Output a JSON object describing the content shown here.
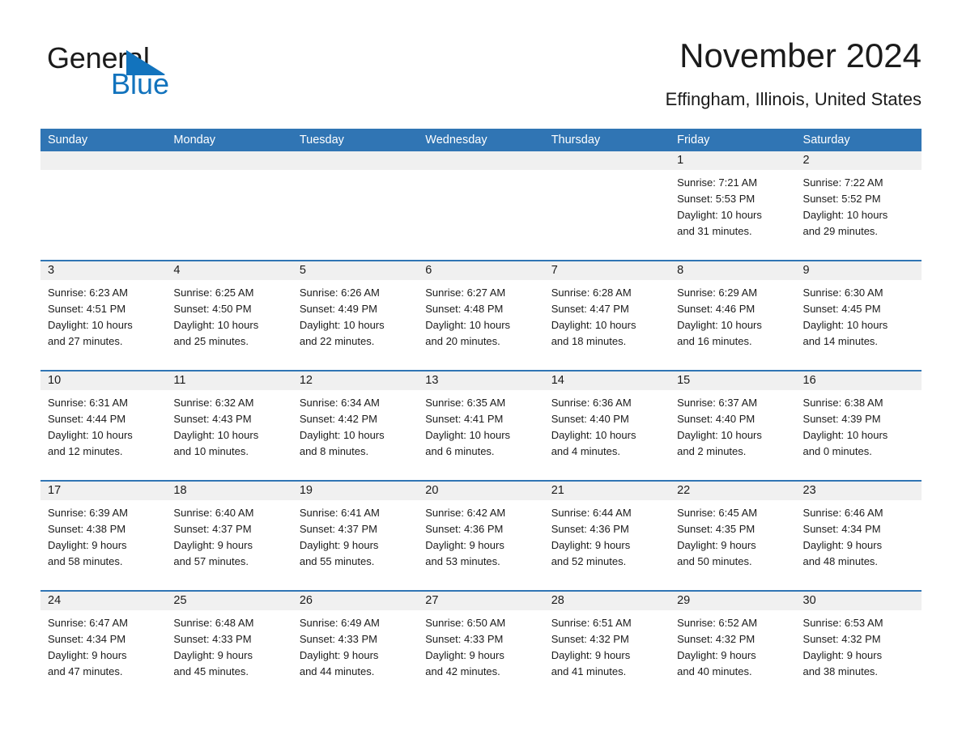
{
  "brand": {
    "word_one": "General",
    "word_two": "Blue",
    "flag_color": "#1273bd"
  },
  "header": {
    "title": "November 2024",
    "subtitle": "Effingham, Illinois, United States"
  },
  "theme": {
    "header_blue": "#3075b4",
    "band_gray": "#f0f0f0",
    "text": "#1b1b1b",
    "brand_blue": "#1273bd"
  },
  "weekdays": [
    "Sunday",
    "Monday",
    "Tuesday",
    "Wednesday",
    "Thursday",
    "Friday",
    "Saturday"
  ],
  "weeks": [
    [
      {
        "day": "",
        "sunrise": "",
        "sunset": "",
        "daylight_1": "",
        "daylight_2": ""
      },
      {
        "day": "",
        "sunrise": "",
        "sunset": "",
        "daylight_1": "",
        "daylight_2": ""
      },
      {
        "day": "",
        "sunrise": "",
        "sunset": "",
        "daylight_1": "",
        "daylight_2": ""
      },
      {
        "day": "",
        "sunrise": "",
        "sunset": "",
        "daylight_1": "",
        "daylight_2": ""
      },
      {
        "day": "",
        "sunrise": "",
        "sunset": "",
        "daylight_1": "",
        "daylight_2": ""
      },
      {
        "day": "1",
        "sunrise": "Sunrise: 7:21 AM",
        "sunset": "Sunset: 5:53 PM",
        "daylight_1": "Daylight: 10 hours",
        "daylight_2": "and 31 minutes."
      },
      {
        "day": "2",
        "sunrise": "Sunrise: 7:22 AM",
        "sunset": "Sunset: 5:52 PM",
        "daylight_1": "Daylight: 10 hours",
        "daylight_2": "and 29 minutes."
      }
    ],
    [
      {
        "day": "3",
        "sunrise": "Sunrise: 6:23 AM",
        "sunset": "Sunset: 4:51 PM",
        "daylight_1": "Daylight: 10 hours",
        "daylight_2": "and 27 minutes."
      },
      {
        "day": "4",
        "sunrise": "Sunrise: 6:25 AM",
        "sunset": "Sunset: 4:50 PM",
        "daylight_1": "Daylight: 10 hours",
        "daylight_2": "and 25 minutes."
      },
      {
        "day": "5",
        "sunrise": "Sunrise: 6:26 AM",
        "sunset": "Sunset: 4:49 PM",
        "daylight_1": "Daylight: 10 hours",
        "daylight_2": "and 22 minutes."
      },
      {
        "day": "6",
        "sunrise": "Sunrise: 6:27 AM",
        "sunset": "Sunset: 4:48 PM",
        "daylight_1": "Daylight: 10 hours",
        "daylight_2": "and 20 minutes."
      },
      {
        "day": "7",
        "sunrise": "Sunrise: 6:28 AM",
        "sunset": "Sunset: 4:47 PM",
        "daylight_1": "Daylight: 10 hours",
        "daylight_2": "and 18 minutes."
      },
      {
        "day": "8",
        "sunrise": "Sunrise: 6:29 AM",
        "sunset": "Sunset: 4:46 PM",
        "daylight_1": "Daylight: 10 hours",
        "daylight_2": "and 16 minutes."
      },
      {
        "day": "9",
        "sunrise": "Sunrise: 6:30 AM",
        "sunset": "Sunset: 4:45 PM",
        "daylight_1": "Daylight: 10 hours",
        "daylight_2": "and 14 minutes."
      }
    ],
    [
      {
        "day": "10",
        "sunrise": "Sunrise: 6:31 AM",
        "sunset": "Sunset: 4:44 PM",
        "daylight_1": "Daylight: 10 hours",
        "daylight_2": "and 12 minutes."
      },
      {
        "day": "11",
        "sunrise": "Sunrise: 6:32 AM",
        "sunset": "Sunset: 4:43 PM",
        "daylight_1": "Daylight: 10 hours",
        "daylight_2": "and 10 minutes."
      },
      {
        "day": "12",
        "sunrise": "Sunrise: 6:34 AM",
        "sunset": "Sunset: 4:42 PM",
        "daylight_1": "Daylight: 10 hours",
        "daylight_2": "and 8 minutes."
      },
      {
        "day": "13",
        "sunrise": "Sunrise: 6:35 AM",
        "sunset": "Sunset: 4:41 PM",
        "daylight_1": "Daylight: 10 hours",
        "daylight_2": "and 6 minutes."
      },
      {
        "day": "14",
        "sunrise": "Sunrise: 6:36 AM",
        "sunset": "Sunset: 4:40 PM",
        "daylight_1": "Daylight: 10 hours",
        "daylight_2": "and 4 minutes."
      },
      {
        "day": "15",
        "sunrise": "Sunrise: 6:37 AM",
        "sunset": "Sunset: 4:40 PM",
        "daylight_1": "Daylight: 10 hours",
        "daylight_2": "and 2 minutes."
      },
      {
        "day": "16",
        "sunrise": "Sunrise: 6:38 AM",
        "sunset": "Sunset: 4:39 PM",
        "daylight_1": "Daylight: 10 hours",
        "daylight_2": "and 0 minutes."
      }
    ],
    [
      {
        "day": "17",
        "sunrise": "Sunrise: 6:39 AM",
        "sunset": "Sunset: 4:38 PM",
        "daylight_1": "Daylight: 9 hours",
        "daylight_2": "and 58 minutes."
      },
      {
        "day": "18",
        "sunrise": "Sunrise: 6:40 AM",
        "sunset": "Sunset: 4:37 PM",
        "daylight_1": "Daylight: 9 hours",
        "daylight_2": "and 57 minutes."
      },
      {
        "day": "19",
        "sunrise": "Sunrise: 6:41 AM",
        "sunset": "Sunset: 4:37 PM",
        "daylight_1": "Daylight: 9 hours",
        "daylight_2": "and 55 minutes."
      },
      {
        "day": "20",
        "sunrise": "Sunrise: 6:42 AM",
        "sunset": "Sunset: 4:36 PM",
        "daylight_1": "Daylight: 9 hours",
        "daylight_2": "and 53 minutes."
      },
      {
        "day": "21",
        "sunrise": "Sunrise: 6:44 AM",
        "sunset": "Sunset: 4:36 PM",
        "daylight_1": "Daylight: 9 hours",
        "daylight_2": "and 52 minutes."
      },
      {
        "day": "22",
        "sunrise": "Sunrise: 6:45 AM",
        "sunset": "Sunset: 4:35 PM",
        "daylight_1": "Daylight: 9 hours",
        "daylight_2": "and 50 minutes."
      },
      {
        "day": "23",
        "sunrise": "Sunrise: 6:46 AM",
        "sunset": "Sunset: 4:34 PM",
        "daylight_1": "Daylight: 9 hours",
        "daylight_2": "and 48 minutes."
      }
    ],
    [
      {
        "day": "24",
        "sunrise": "Sunrise: 6:47 AM",
        "sunset": "Sunset: 4:34 PM",
        "daylight_1": "Daylight: 9 hours",
        "daylight_2": "and 47 minutes."
      },
      {
        "day": "25",
        "sunrise": "Sunrise: 6:48 AM",
        "sunset": "Sunset: 4:33 PM",
        "daylight_1": "Daylight: 9 hours",
        "daylight_2": "and 45 minutes."
      },
      {
        "day": "26",
        "sunrise": "Sunrise: 6:49 AM",
        "sunset": "Sunset: 4:33 PM",
        "daylight_1": "Daylight: 9 hours",
        "daylight_2": "and 44 minutes."
      },
      {
        "day": "27",
        "sunrise": "Sunrise: 6:50 AM",
        "sunset": "Sunset: 4:33 PM",
        "daylight_1": "Daylight: 9 hours",
        "daylight_2": "and 42 minutes."
      },
      {
        "day": "28",
        "sunrise": "Sunrise: 6:51 AM",
        "sunset": "Sunset: 4:32 PM",
        "daylight_1": "Daylight: 9 hours",
        "daylight_2": "and 41 minutes."
      },
      {
        "day": "29",
        "sunrise": "Sunrise: 6:52 AM",
        "sunset": "Sunset: 4:32 PM",
        "daylight_1": "Daylight: 9 hours",
        "daylight_2": "and 40 minutes."
      },
      {
        "day": "30",
        "sunrise": "Sunrise: 6:53 AM",
        "sunset": "Sunset: 4:32 PM",
        "daylight_1": "Daylight: 9 hours",
        "daylight_2": "and 38 minutes."
      }
    ]
  ]
}
